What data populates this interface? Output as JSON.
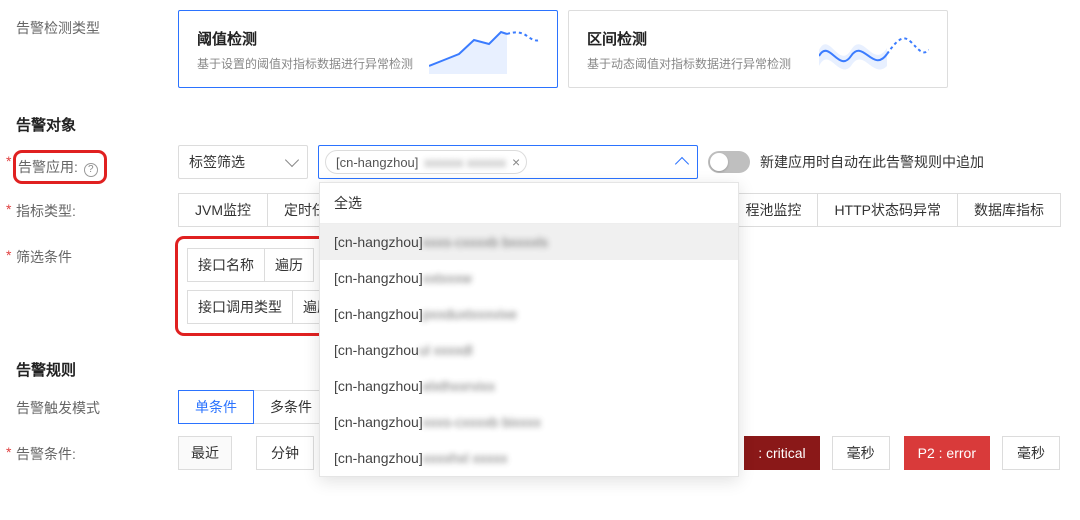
{
  "detection": {
    "label": "告警检测类型",
    "cards": [
      {
        "title": "阈值检测",
        "subtitle": "基于设置的阈值对指标数据进行异常检测",
        "selected": true
      },
      {
        "title": "区间检测",
        "subtitle": "基于动态阈值对指标数据进行异常检测",
        "selected": false
      }
    ]
  },
  "target": {
    "section": "告警对象",
    "app_label": "告警应用:",
    "tag_filter": "标签筛选",
    "selected_app_prefix": "[cn-hangzhou]",
    "selected_app_blur": "xxxxxx  xxxxxx",
    "auto_add_label": "新建应用时自动在此告警规则中追加"
  },
  "dropdown": {
    "select_all": "全选",
    "items": [
      {
        "prefix": "[cn-hangzhou]",
        "blur": "xxxs-cxxxxb  bxxxxls"
      },
      {
        "prefix": "[cn-hangzhou]",
        "blur": "xxtxxxw"
      },
      {
        "prefix": "[cn-hangzhou]",
        "blur": "pxxduxtxxxvixe"
      },
      {
        "prefix": "[cn-hangzhou",
        "blur": "ul  xxxxdl"
      },
      {
        "prefix": "[cn-hangzhou]",
        "blur": "elxthxxrvixx"
      },
      {
        "prefix": "[cn-hangzhou]",
        "blur": "xxxs-cxxxxb  bixxxx"
      },
      {
        "prefix": "[cn-hangzhou]",
        "blur": "xxxxhxl  xxxxx"
      }
    ]
  },
  "metric": {
    "label": "指标类型:",
    "options_visible": [
      "JVM监控",
      "定时任务"
    ],
    "options_right": [
      "程池监控",
      "HTTP状态码异常",
      "数据库指标"
    ]
  },
  "filter": {
    "label": "筛选条件",
    "lines": [
      {
        "name": "接口名称",
        "value": "遍历"
      },
      {
        "name": "接口调用类型",
        "value": "遍历"
      }
    ]
  },
  "rule": {
    "section": "告警规则",
    "trigger_label": "告警触发模式",
    "trigger_options": [
      "单条件",
      "多条件"
    ],
    "trigger_active": "单条件",
    "cond_label": "告警条件:",
    "recent": "最近",
    "minute": "分钟",
    "ms": "毫秒",
    "sev_critical": ": critical",
    "sev_error": "P2 : error"
  }
}
